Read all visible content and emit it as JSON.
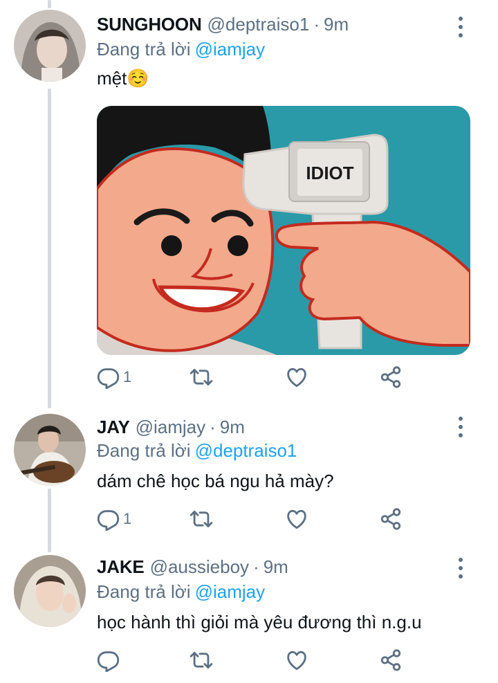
{
  "tweets": [
    {
      "name": "SUNGHOON",
      "handle": "@deptraiso1",
      "separator": "·",
      "time": "9m",
      "replying_label": "Đang trả lời",
      "replying_to": "@iamjay",
      "text": "mệt☺️",
      "media_text": "IDIOT",
      "reply_count": "1",
      "retweet_count": "",
      "like_count": ""
    },
    {
      "name": "JAY",
      "handle": "@iamjay",
      "separator": "·",
      "time": "9m",
      "replying_label": "Đang trả lời",
      "replying_to": "@deptraiso1",
      "text": "dám chê học bá ngu hả mày?",
      "reply_count": "1",
      "retweet_count": "",
      "like_count": ""
    },
    {
      "name": "JAKE",
      "handle": "@aussieboy",
      "separator": "·",
      "time": "9m",
      "replying_label": "Đang trả lời",
      "replying_to": "@iamjay",
      "text": "học hành thì giỏi mà yêu đương thì n.g.u",
      "reply_count": "",
      "retweet_count": "",
      "like_count": ""
    }
  ],
  "icons": {
    "reply": "reply-icon",
    "retweet": "retweet-icon",
    "like": "heart-icon",
    "share": "share-icon",
    "more": "more-vertical-icon"
  },
  "colors": {
    "text": "#0f1419",
    "secondary": "#5b7083",
    "link": "#1da1f2",
    "thread_line": "#d6dade"
  }
}
